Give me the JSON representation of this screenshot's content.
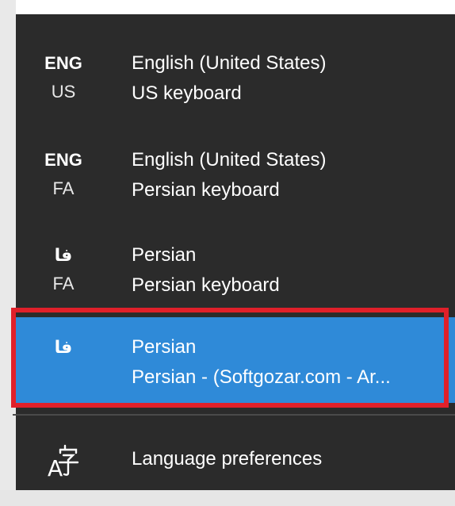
{
  "input_menu": {
    "items": [
      {
        "code_top": "ENG",
        "code_bottom": "US",
        "language": "English (United States)",
        "keyboard": "US keyboard",
        "selected": false
      },
      {
        "code_top": "ENG",
        "code_bottom": "FA",
        "language": "English (United States)",
        "keyboard": "Persian keyboard",
        "selected": false
      },
      {
        "code_top": "فا",
        "code_bottom": "FA",
        "language": "Persian",
        "keyboard": "Persian keyboard",
        "selected": false
      },
      {
        "code_top": "فا",
        "code_bottom": "",
        "language": "Persian",
        "keyboard": "Persian - (Softgozar.com - Ar...",
        "selected": true
      }
    ],
    "preferences_label": "Language preferences",
    "preferences_icon": "language-preferences-icon"
  },
  "colors": {
    "flyout_background": "#2b2b2b",
    "selected_background": "#2f8ad8",
    "annotation_frame": "#e0202a"
  }
}
